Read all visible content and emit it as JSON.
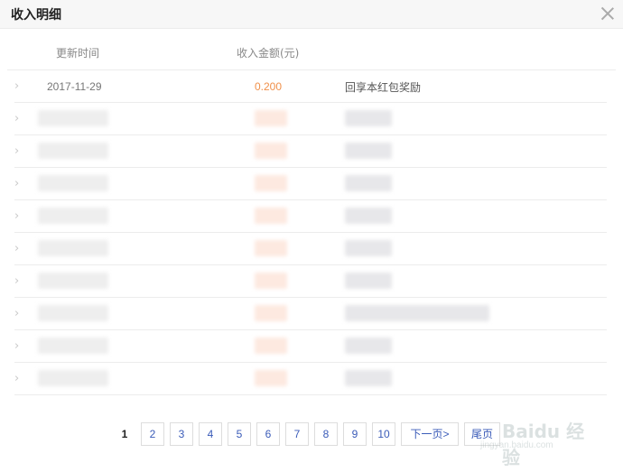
{
  "dialog": {
    "title": "收入明细"
  },
  "table": {
    "headers": {
      "time": "更新时间",
      "amount": "收入金额(元)"
    },
    "rows": [
      {
        "time": "2017-11-29",
        "amount": "0.200",
        "desc": "回享本红包奖励"
      }
    ],
    "obscured_row_count": 9
  },
  "pagination": {
    "current": "1",
    "pages": [
      "2",
      "3",
      "4",
      "5",
      "6",
      "7",
      "8",
      "9",
      "10"
    ],
    "next_label": "下一页>",
    "last_label": "尾页"
  },
  "watermark": {
    "brand": "Baidu 经验",
    "sub": "jingyan.baidu.com"
  },
  "colors": {
    "amount": "#f0904a",
    "link": "#3a5bb8"
  }
}
